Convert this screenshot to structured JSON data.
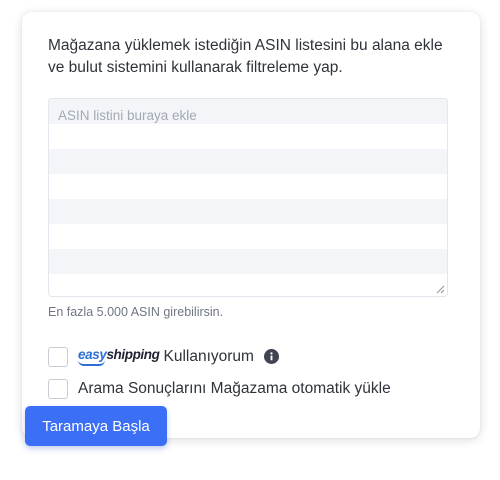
{
  "description": "Mağazana yüklemek istediğin ASIN listesini bu alana ekle ve bulut sistemini kullanarak filtreleme yap.",
  "asin_input": {
    "placeholder": "ASIN listini buraya ekle",
    "value": ""
  },
  "hint": "En fazla 5.000 ASIN girebilirsin.",
  "options": [
    {
      "logo_part1": "easy",
      "logo_part2": "shipping",
      "label": "Kullanıyorum",
      "checked": false,
      "icon": "info-icon"
    },
    {
      "label": "Arama Sonuçlarını Mağazama otomatik yükle",
      "checked": false
    }
  ],
  "start_button": "Taramaya Başla",
  "colors": {
    "primary": "#3b6ff5",
    "logo_blue": "#2c6fd6",
    "row_stripe": "#f3f5f9"
  }
}
